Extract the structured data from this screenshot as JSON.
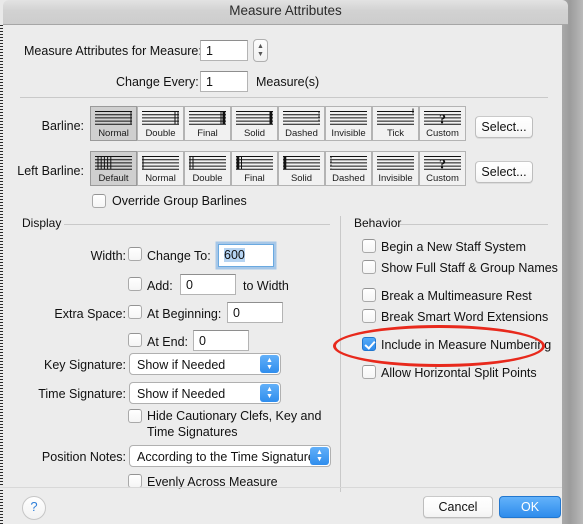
{
  "window": {
    "title": "Measure Attributes"
  },
  "top": {
    "measure_label": "Measure Attributes for Measure:",
    "measure_value": "1",
    "change_every_label": "Change Every:",
    "change_every_value": "1",
    "measures_suffix": "Measure(s)"
  },
  "barline": {
    "label": "Barline:",
    "select_label": "Select...",
    "options": [
      "Normal",
      "Double",
      "Final",
      "Solid",
      "Dashed",
      "Invisible",
      "Tick",
      "Custom"
    ],
    "selected": "Normal"
  },
  "left_barline": {
    "label": "Left Barline:",
    "select_label": "Select...",
    "options": [
      "Default",
      "Normal",
      "Double",
      "Final",
      "Solid",
      "Dashed",
      "Invisible",
      "Custom"
    ],
    "selected": "Default"
  },
  "override_group_barlines": {
    "label": "Override Group Barlines",
    "checked": false
  },
  "display": {
    "title": "Display",
    "width_label": "Width:",
    "change_to_label": "Change To:",
    "change_to_checked": false,
    "change_to_value": "600",
    "add_label": "Add:",
    "add_checked": false,
    "add_value": "0",
    "to_width_label": "to Width",
    "extra_space_label": "Extra Space:",
    "at_beginning_label": "At Beginning:",
    "at_beginning_checked": false,
    "at_beginning_value": "0",
    "at_end_label": "At End:",
    "at_end_checked": false,
    "at_end_value": "0",
    "key_signature_label": "Key Signature:",
    "key_signature_value": "Show if Needed",
    "time_signature_label": "Time Signature:",
    "time_signature_value": "Show if Needed",
    "hide_cautionary_line1": "Hide Cautionary Clefs, Key and",
    "hide_cautionary_line2": "Time Signatures",
    "hide_cautionary_checked": false,
    "position_notes_label": "Position Notes:",
    "position_notes_value": "According to the Time Signature",
    "evenly_label": "Evenly Across Measure",
    "evenly_checked": false
  },
  "behavior": {
    "title": "Behavior",
    "items": [
      {
        "label": "Begin a New Staff System",
        "checked": false
      },
      {
        "label": "Show Full Staff & Group Names",
        "checked": false
      },
      {
        "label": "Break a Multimeasure Rest",
        "checked": false
      },
      {
        "label": "Break Smart Word Extensions",
        "checked": false
      },
      {
        "label": "Include in Measure Numbering",
        "checked": true
      },
      {
        "label": "Allow Horizontal Split Points",
        "checked": false
      }
    ]
  },
  "footer": {
    "help_label": "?",
    "cancel_label": "Cancel",
    "ok_label": "OK"
  },
  "annotation": {
    "color": "#e8291c",
    "target": "Include in Measure Numbering"
  }
}
